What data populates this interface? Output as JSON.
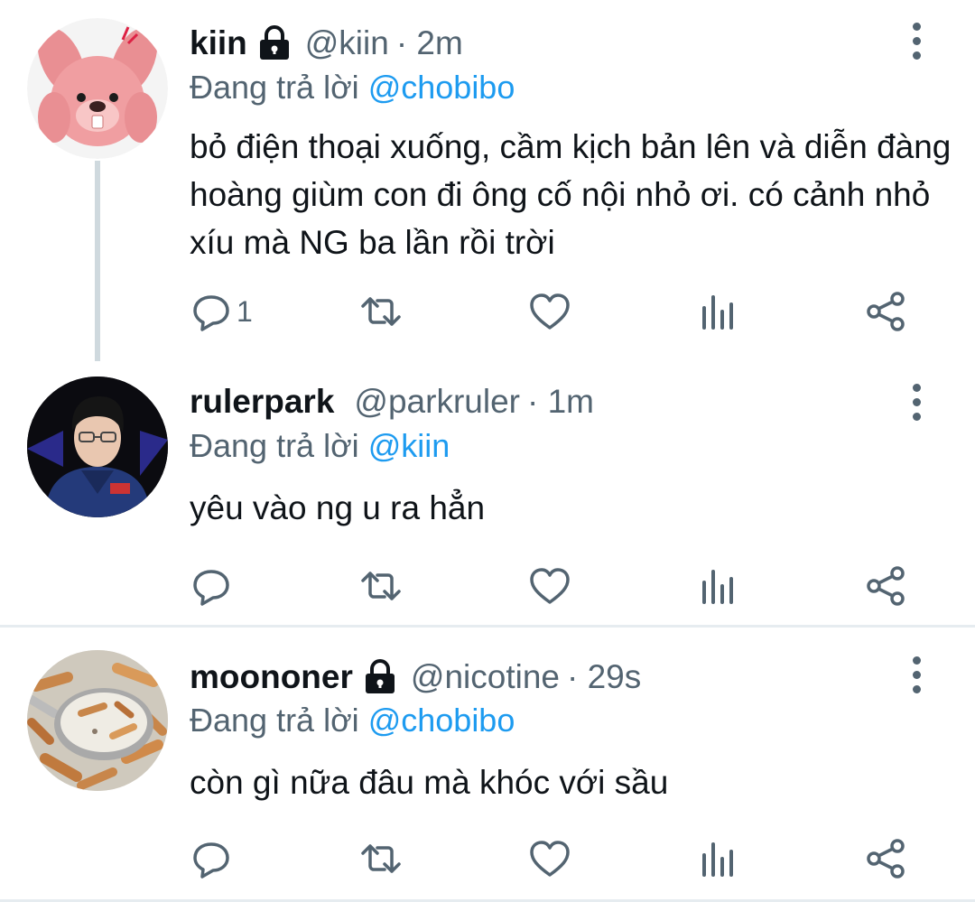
{
  "colors": {
    "text": "#0f1419",
    "muted": "#536471",
    "link": "#1d9bf0",
    "divider": "#e6ecf0",
    "thread_line": "#cfd9de"
  },
  "tweets": [
    {
      "name": "kiin",
      "locked": true,
      "handle": "@kiin",
      "time": "· 2m",
      "replying_label": "Đang trả lời",
      "replying_to": "@chobibo",
      "text": "bỏ điện thoại xuống, cầm kịch bản lên và diễn đàng hoàng giùm con đi ông cố nội nhỏ ơi. có cảnh nhỏ xíu mà NG ba lần rồi trời",
      "reply_count": "1",
      "avatar": "pink-plush-beaver"
    },
    {
      "name": "rulerpark",
      "locked": false,
      "handle": "@parkruler",
      "time": "· 1m",
      "replying_label": "Đang trả lời",
      "replying_to": "@kiin",
      "text": "yêu vào ng u ra hẳn",
      "reply_count": "",
      "avatar": "player-in-jersey"
    },
    {
      "name": "moononer",
      "locked": true,
      "handle": "@nicotine",
      "time": "· 29s",
      "replying_label": "Đang trả lời",
      "replying_to": "@chobibo",
      "text": "còn gì nữa đâu mà khóc với sầu",
      "reply_count": "",
      "avatar": "cigarette-butts-spoon"
    }
  ],
  "icons": {
    "reply": "reply-icon",
    "retweet": "retweet-icon",
    "like": "heart-icon",
    "analytics": "analytics-icon",
    "share": "share-icon",
    "more": "more-vertical-icon",
    "lock": "lock-icon"
  }
}
